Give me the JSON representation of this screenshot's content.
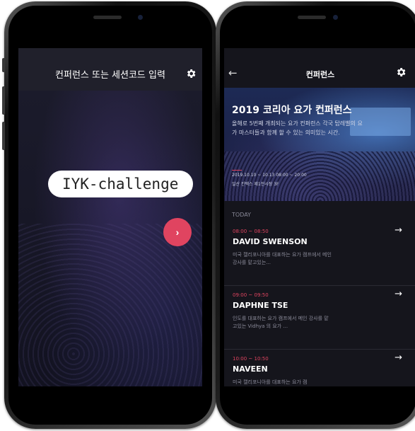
{
  "screen1": {
    "title": "컨퍼런스 또는 세션코드 입력",
    "code_input_value": "IYK-challenge",
    "go_button_label": "›",
    "icons": {
      "settings": "gear-icon",
      "go": "chevron-right-icon"
    }
  },
  "screen2": {
    "back_label": "←",
    "title": "컨퍼런스",
    "hero": {
      "title": "2019 코리아 요가 컨퍼런스",
      "description": "올해로 5번째 개최되는 요가 컨퍼런스 각국 탑레벨의 요가 마스터들과 함께 할 수 있는 의미있는 시간.",
      "date": "2019.10.10 ~ 10.13   08:00 ~ 20:00",
      "place": "일산 킨텍스 제1전시장 3F"
    },
    "section_label": "TODAY",
    "sessions": [
      {
        "time": "08:00 ~ 08:50",
        "name": "DAVID SWENSON",
        "desc": "미국 캘리포니아를 대표하는 요가 캠프에서 메인 강사를 맡고있는...",
        "arrow": "→"
      },
      {
        "time": "09:00 ~ 09:50",
        "name": "DAPHNE TSE",
        "desc": "인도를 대표하는 요가 캠프에서 메인 강사를 맡고있는 Vidhya 의 요가 ...",
        "arrow": "→"
      },
      {
        "time": "10:00 ~ 10:50",
        "name": "NAVEEN",
        "desc": "미국 캘리포니아를 대표하는 요가 캠",
        "arrow": "→"
      }
    ],
    "icons": {
      "settings": "gear-icon",
      "back": "arrow-left-icon",
      "session_arrow": "arrow-right-icon"
    }
  },
  "colors": {
    "accent": "#e04460",
    "background": "#15151c",
    "text_muted": "#8a8a99"
  }
}
